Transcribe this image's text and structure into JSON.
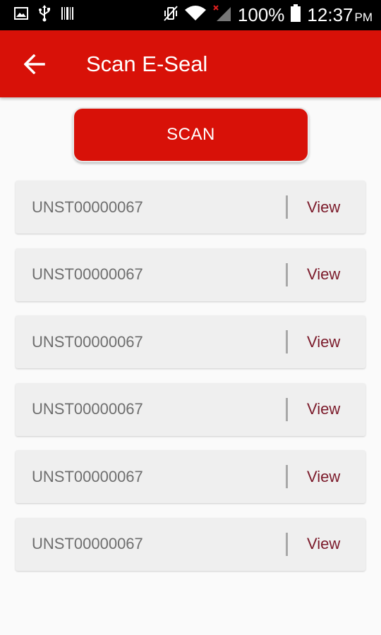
{
  "status_bar": {
    "battery_percent": "100%",
    "time": "12:37",
    "time_suffix": "PM",
    "icons": [
      "gallery-icon",
      "usb-icon",
      "barcode-icon",
      "vibrate-mute-icon",
      "wifi-icon",
      "signal-no-service-icon",
      "battery-icon"
    ]
  },
  "app_bar": {
    "title": "Scan E-Seal",
    "back_icon": "arrow-left-icon"
  },
  "scan_button": {
    "label": "SCAN"
  },
  "seals": [
    {
      "id": "UNST00000067",
      "action": "View"
    },
    {
      "id": "UNST00000067",
      "action": "View"
    },
    {
      "id": "UNST00000067",
      "action": "View"
    },
    {
      "id": "UNST00000067",
      "action": "View"
    },
    {
      "id": "UNST00000067",
      "action": "View"
    },
    {
      "id": "UNST00000067",
      "action": "View"
    }
  ],
  "colors": {
    "primary": "#d81108",
    "view_text": "#7b1a2a",
    "row_bg": "#efefef"
  }
}
